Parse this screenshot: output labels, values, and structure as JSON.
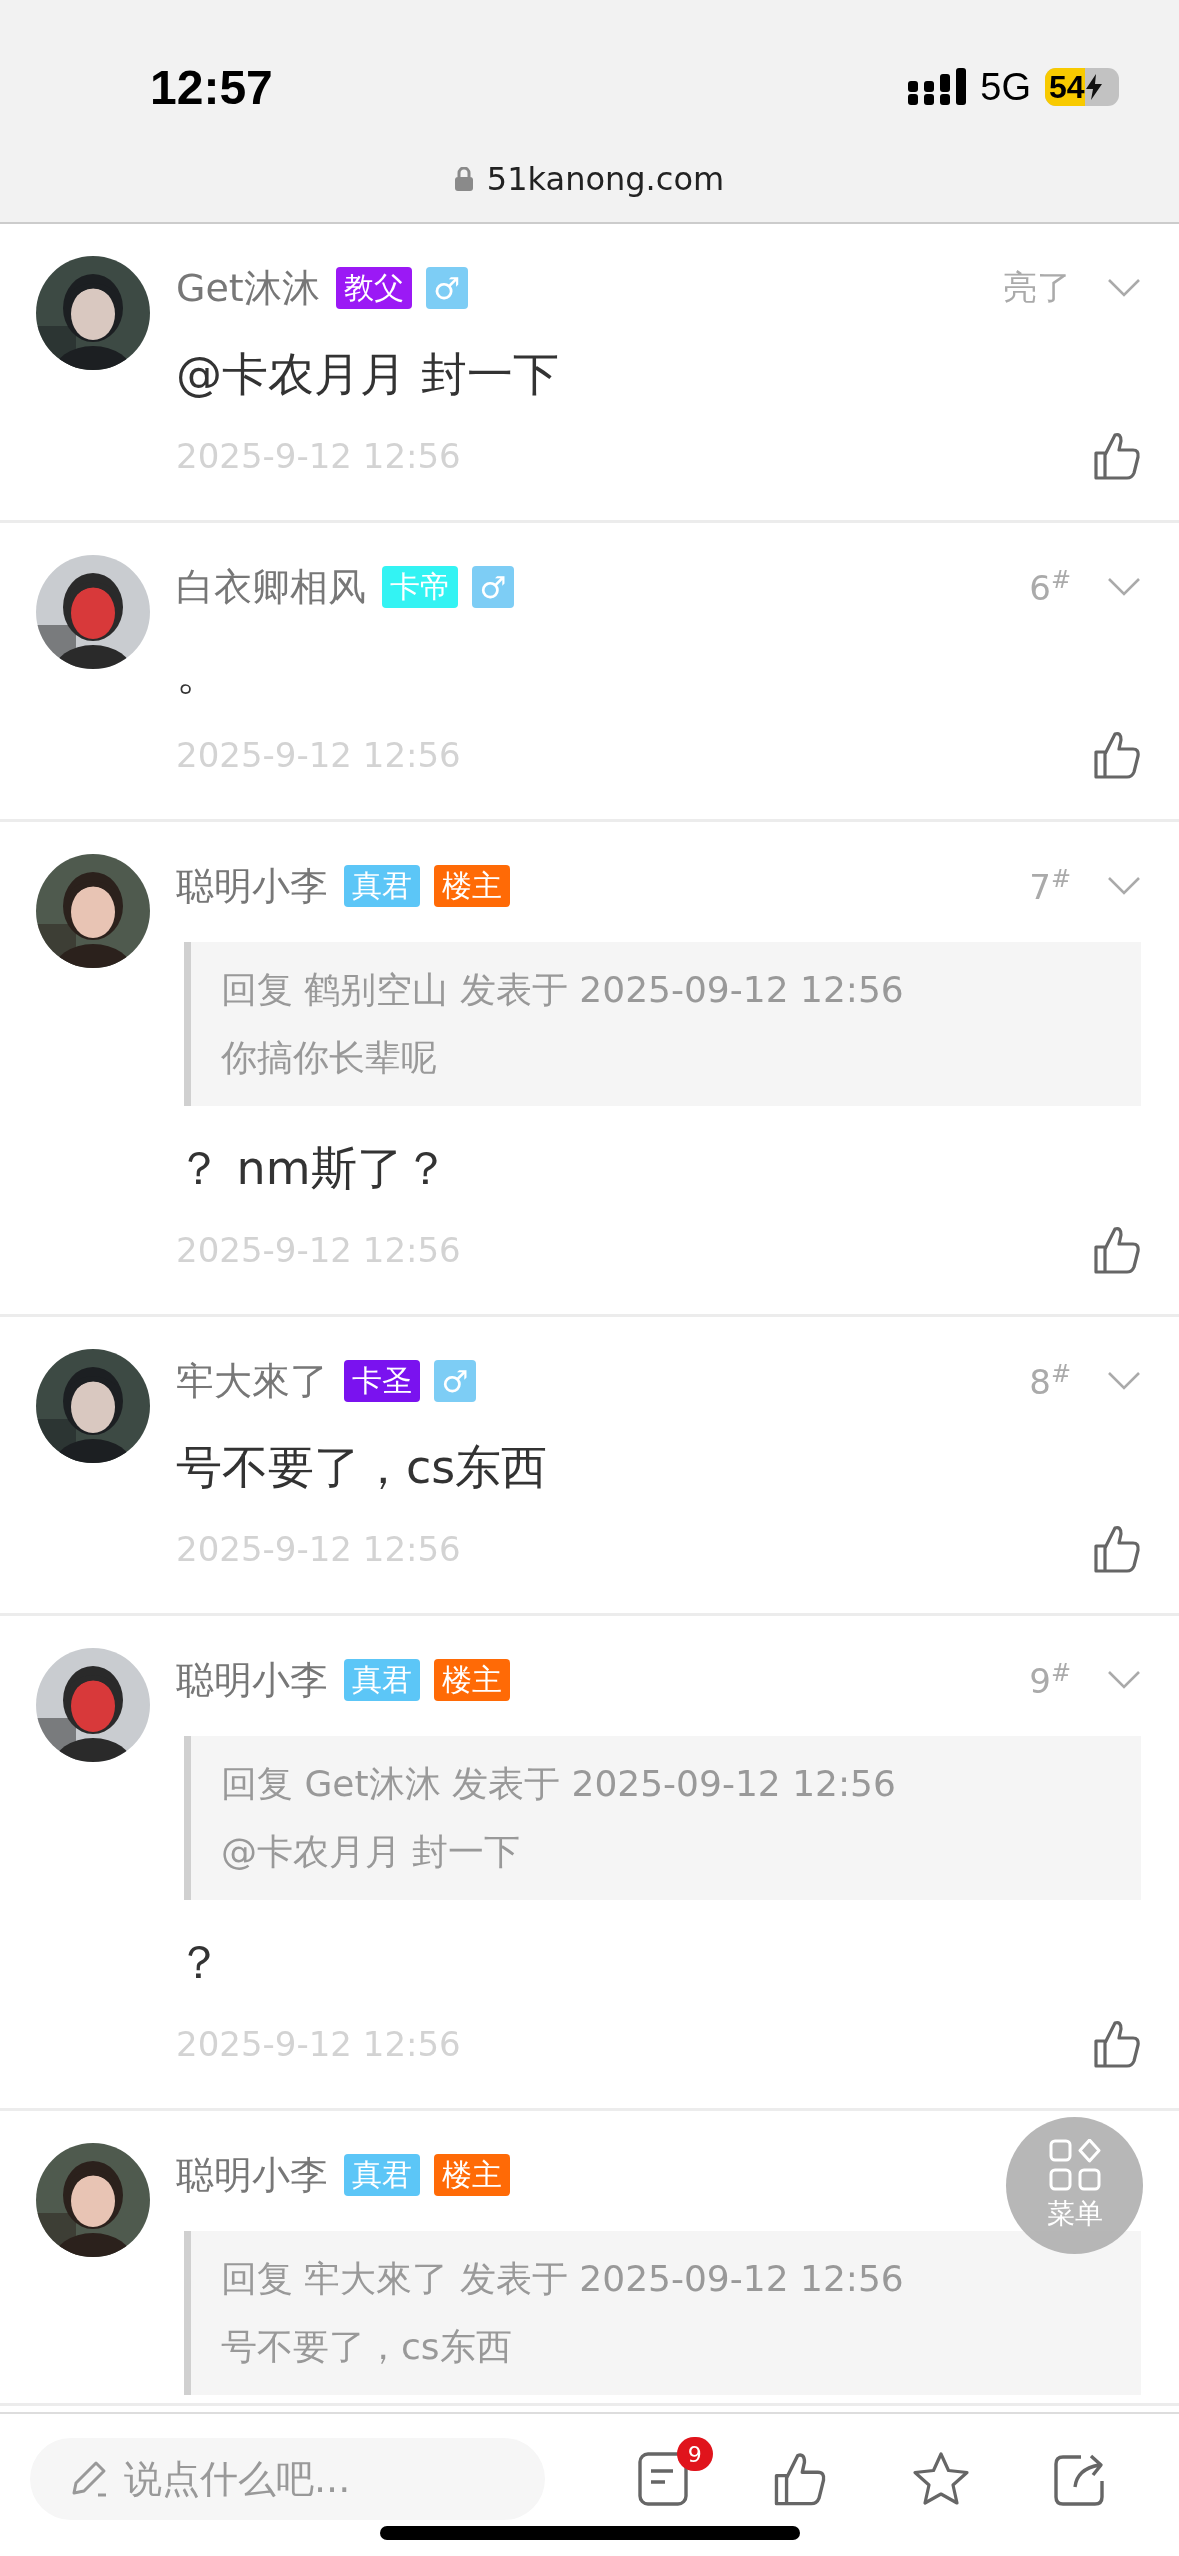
{
  "status_bar": {
    "time": "12:57",
    "network": "5G",
    "battery": "54"
  },
  "address_bar": {
    "url": "51kanong.com"
  },
  "posts": [
    {
      "author": "Get沐沐",
      "tags": [
        {
          "label": "教父",
          "color": "#9b19f5"
        }
      ],
      "gender": "♂",
      "floor": "亮了",
      "content": "@卡农月月 封一下",
      "time": "2025-9-12 12:56"
    },
    {
      "author": "白衣卿相风",
      "tags": [
        {
          "label": "卡帝",
          "color": "#33f3f3"
        }
      ],
      "gender": "♂",
      "floor": "6$^{#}$",
      "content": "。",
      "time": "2025-9-12 12:56"
    },
    {
      "author": "聪明小李",
      "tags": [
        {
          "label": "真君",
          "color": "#5cc6f7"
        },
        {
          "label": "楼主",
          "color": "#ff6a06"
        }
      ],
      "floor": "7$^{#}$",
      "quote": {
        "header": "回复 鹤别空山 发表于 2025-09-12 12:56",
        "text": "你搞你长辈呢"
      },
      "content": "？ nm斯了？",
      "time": "2025-9-12 12:56"
    },
    {
      "author": "牢大來了",
      "tags": [
        {
          "label": "卡圣",
          "color": "#7a12ef"
        }
      ],
      "gender": "♂",
      "floor": "8$^{#}$",
      "content": "号不要了，cs东西",
      "time": "2025-9-12 12:56"
    },
    {
      "author": "聪明小李",
      "tags": [
        {
          "label": "真君",
          "color": "#5cc6f7"
        },
        {
          "label": "楼主",
          "color": "#ff6a06"
        }
      ],
      "floor": "9$^{#}$",
      "quote": {
        "header": "回复 Get沐沐 发表于 2025-09-12 12:56",
        "text": "@卡农月月 封一下"
      },
      "content": "？",
      "time": "2025-9-12 12:56"
    },
    {
      "author": "聪明小李",
      "tags": [
        {
          "label": "真君",
          "color": "#5cc6f7"
        },
        {
          "label": "楼主",
          "color": "#ff6a06"
        }
      ],
      "quote": {
        "header": "回复 牢大來了 发表于 2025-09-12 12:56",
        "text": "号不要了，cs东西"
      }
    }
  ],
  "menu_button": {
    "label": "菜单"
  },
  "bottom_bar": {
    "placeholder": "说点什么吧...",
    "comment_count": "9"
  }
}
